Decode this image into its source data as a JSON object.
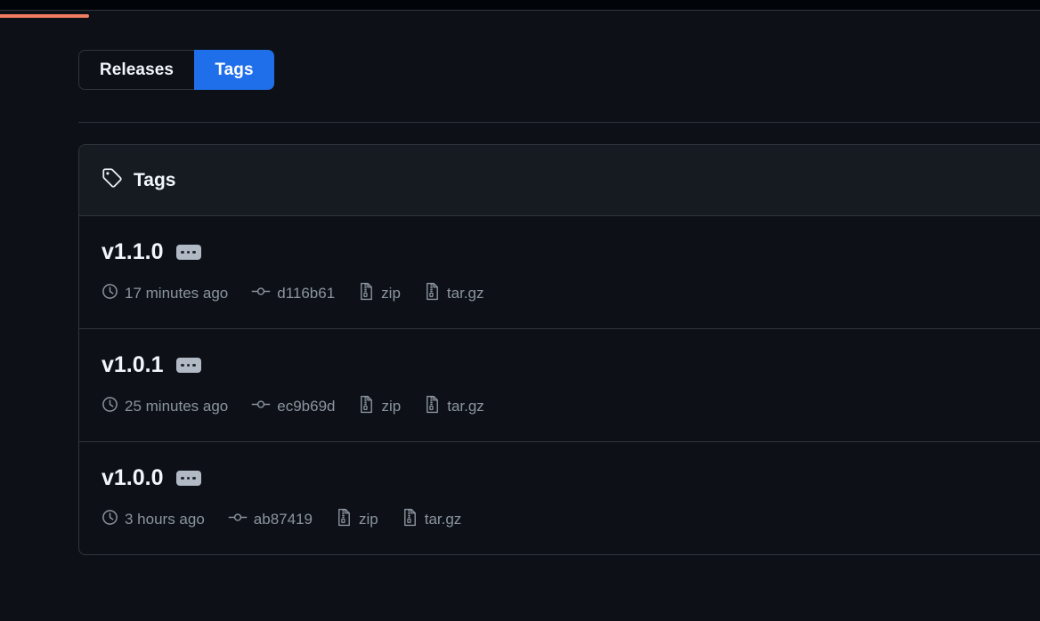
{
  "chrome": {
    "loading_progress_percent": 9,
    "progress_color": "#f07c62",
    "background_color": "#010409"
  },
  "theme": {
    "page_background": "#0d1117",
    "card_header_background": "#161b22",
    "border_color": "#30363d",
    "accent_blue": "#1f6feb",
    "muted_text": "#8b949e",
    "primary_text": "#f0f6fc"
  },
  "segmented_control": {
    "releases_label": "Releases",
    "tags_label": "Tags",
    "selected": "Tags"
  },
  "card": {
    "header_title": "Tags",
    "header_icon": "tag-icon"
  },
  "tags": [
    {
      "name": "v1.1.0",
      "menu_icon": "kebab-horizontal-icon",
      "time_icon": "clock-icon",
      "time": "17 minutes ago",
      "commit_icon": "git-commit-icon",
      "commit": "d116b61",
      "zip_icon": "file-zip-icon",
      "zip_label": "zip",
      "targz_icon": "file-zip-icon",
      "targz_label": "tar.gz"
    },
    {
      "name": "v1.0.1",
      "menu_icon": "kebab-horizontal-icon",
      "time_icon": "clock-icon",
      "time": "25 minutes ago",
      "commit_icon": "git-commit-icon",
      "commit": "ec9b69d",
      "zip_icon": "file-zip-icon",
      "zip_label": "zip",
      "targz_icon": "file-zip-icon",
      "targz_label": "tar.gz"
    },
    {
      "name": "v1.0.0",
      "menu_icon": "kebab-horizontal-icon",
      "time_icon": "clock-icon",
      "time": "3 hours ago",
      "commit_icon": "git-commit-icon",
      "commit": "ab87419",
      "zip_icon": "file-zip-icon",
      "zip_label": "zip",
      "targz_icon": "file-zip-icon",
      "targz_label": "tar.gz"
    }
  ]
}
